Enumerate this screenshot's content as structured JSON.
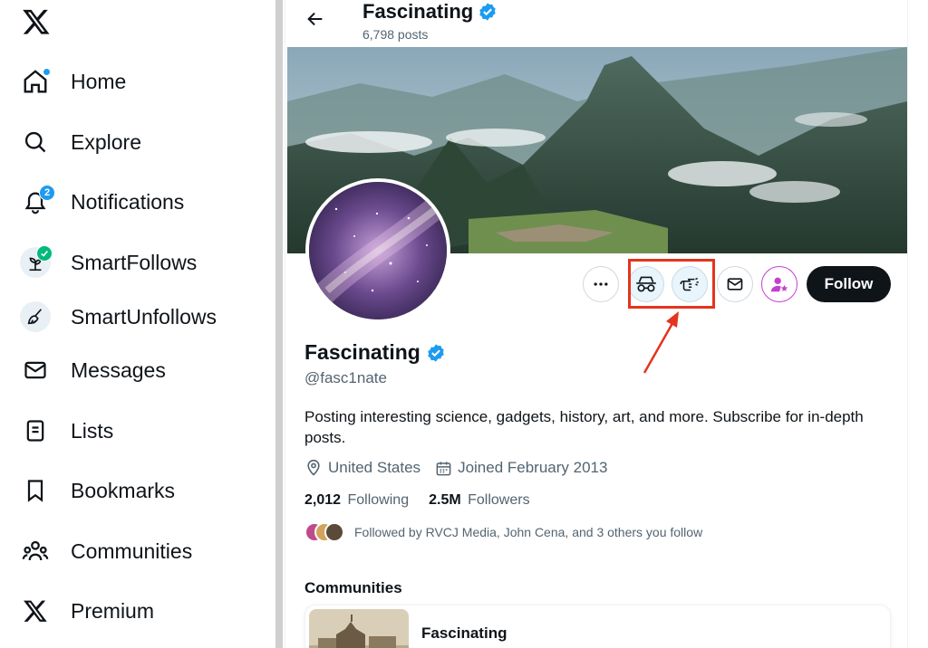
{
  "sidebar": {
    "items": [
      {
        "label": "Home",
        "icon": "home-icon"
      },
      {
        "label": "Explore",
        "icon": "search-icon"
      },
      {
        "label": "Notifications",
        "icon": "bell-icon",
        "badge": "2"
      },
      {
        "label": "SmartFollows",
        "icon": "sprout-icon"
      },
      {
        "label": "SmartUnfollows",
        "icon": "broom-icon"
      },
      {
        "label": "Messages",
        "icon": "mail-icon"
      },
      {
        "label": "Lists",
        "icon": "list-icon"
      },
      {
        "label": "Bookmarks",
        "icon": "bookmark-icon"
      },
      {
        "label": "Communities",
        "icon": "people-icon"
      },
      {
        "label": "Premium",
        "icon": "x-logo-icon"
      }
    ]
  },
  "header": {
    "name": "Fascinating",
    "posts": "6,798 posts"
  },
  "profile": {
    "name": "Fascinating",
    "handle": "@fasc1nate",
    "bio": "Posting interesting science, gadgets, history, art, and more. Subscribe for in-depth posts.",
    "location": "United States",
    "joined": "Joined February 2013",
    "following_count": "2,012",
    "following_label": "Following",
    "followers_count": "2.5M",
    "followers_label": "Followers",
    "followed_by": "Followed by RVCJ Media, John Cena, and 3 others you follow"
  },
  "actions": {
    "follow_label": "Follow"
  },
  "communities": {
    "title": "Communities",
    "items": [
      {
        "name": "Fascinating"
      }
    ]
  },
  "colors": {
    "accent": "#1d9bf0",
    "highlight": "#e4331e",
    "follow_bg": "#0f1419",
    "premium_purple": "#c53fd1"
  }
}
